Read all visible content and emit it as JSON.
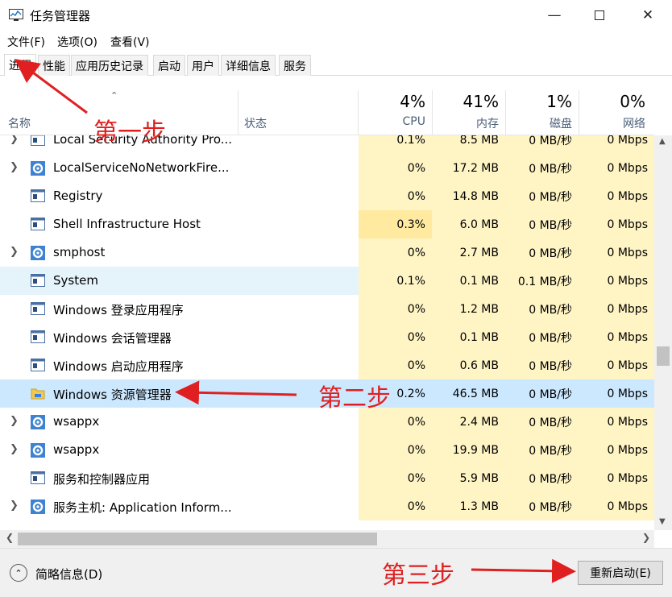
{
  "window": {
    "title": "任务管理器"
  },
  "menu": [
    "文件(F)",
    "选项(O)",
    "查看(V)"
  ],
  "tabs": [
    "进程",
    "性能",
    "应用历史记录",
    "启动",
    "用户",
    "详细信息",
    "服务"
  ],
  "columns": {
    "name": "名称",
    "status": "状态",
    "cpu": {
      "pct": "4%",
      "label": "CPU"
    },
    "mem": {
      "pct": "41%",
      "label": "内存"
    },
    "disk": {
      "pct": "1%",
      "label": "磁盘"
    },
    "net": {
      "pct": "0%",
      "label": "网络"
    }
  },
  "rows": [
    {
      "name": "Local Security Authority Pro...",
      "cpu": "0.1%",
      "mem": "8.5 MB",
      "disk": "0 MB/秒",
      "net": "0 Mbps",
      "expand": true,
      "icon": "app-window-icon"
    },
    {
      "name": "LocalServiceNoNetworkFire...",
      "cpu": "0%",
      "mem": "17.2 MB",
      "disk": "0 MB/秒",
      "net": "0 Mbps",
      "expand": true,
      "icon": "gear-icon"
    },
    {
      "name": "Registry",
      "cpu": "0%",
      "mem": "14.8 MB",
      "disk": "0 MB/秒",
      "net": "0 Mbps",
      "expand": false,
      "icon": "app-window-icon"
    },
    {
      "name": "Shell Infrastructure Host",
      "cpu": "0.3%",
      "mem": "6.0 MB",
      "disk": "0 MB/秒",
      "net": "0 Mbps",
      "expand": false,
      "icon": "app-window-icon"
    },
    {
      "name": "smphost",
      "cpu": "0%",
      "mem": "2.7 MB",
      "disk": "0 MB/秒",
      "net": "0 Mbps",
      "expand": true,
      "icon": "gear-icon"
    },
    {
      "name": "System",
      "cpu": "0.1%",
      "mem": "0.1 MB",
      "disk": "0.1 MB/秒",
      "net": "0 Mbps",
      "expand": false,
      "icon": "app-window-icon"
    },
    {
      "name": "Windows 登录应用程序",
      "cpu": "0%",
      "mem": "1.2 MB",
      "disk": "0 MB/秒",
      "net": "0 Mbps",
      "expand": false,
      "icon": "app-window-icon"
    },
    {
      "name": "Windows 会话管理器",
      "cpu": "0%",
      "mem": "0.1 MB",
      "disk": "0 MB/秒",
      "net": "0 Mbps",
      "expand": false,
      "icon": "app-window-icon"
    },
    {
      "name": "Windows 启动应用程序",
      "cpu": "0%",
      "mem": "0.6 MB",
      "disk": "0 MB/秒",
      "net": "0 Mbps",
      "expand": false,
      "icon": "app-window-icon"
    },
    {
      "name": "Windows 资源管理器",
      "cpu": "0.2%",
      "mem": "46.5 MB",
      "disk": "0 MB/秒",
      "net": "0 Mbps",
      "expand": false,
      "icon": "folder-icon"
    },
    {
      "name": "wsappx",
      "cpu": "0%",
      "mem": "2.4 MB",
      "disk": "0 MB/秒",
      "net": "0 Mbps",
      "expand": true,
      "icon": "gear-icon"
    },
    {
      "name": "wsappx",
      "cpu": "0%",
      "mem": "19.9 MB",
      "disk": "0 MB/秒",
      "net": "0 Mbps",
      "expand": true,
      "icon": "gear-icon"
    },
    {
      "name": "服务和控制器应用",
      "cpu": "0%",
      "mem": "5.9 MB",
      "disk": "0 MB/秒",
      "net": "0 Mbps",
      "expand": false,
      "icon": "app-window-icon"
    },
    {
      "name": "服务主机: Application Inform...",
      "cpu": "0%",
      "mem": "1.3 MB",
      "disk": "0 MB/秒",
      "net": "0 Mbps",
      "expand": true,
      "icon": "gear-icon"
    }
  ],
  "footer": {
    "fewer_details": "简略信息(D)",
    "restart_button": "重新启动(E)"
  },
  "annotations": {
    "step1": "第一步",
    "step2": "第二步",
    "step3": "第三步"
  },
  "colors": {
    "cpu_heat_light": "#fff4c4",
    "cpu_heat_med": "#ffeaa0",
    "selected": "#cce8ff",
    "hover": "#e5f3fb",
    "annotation": "#e02020"
  }
}
